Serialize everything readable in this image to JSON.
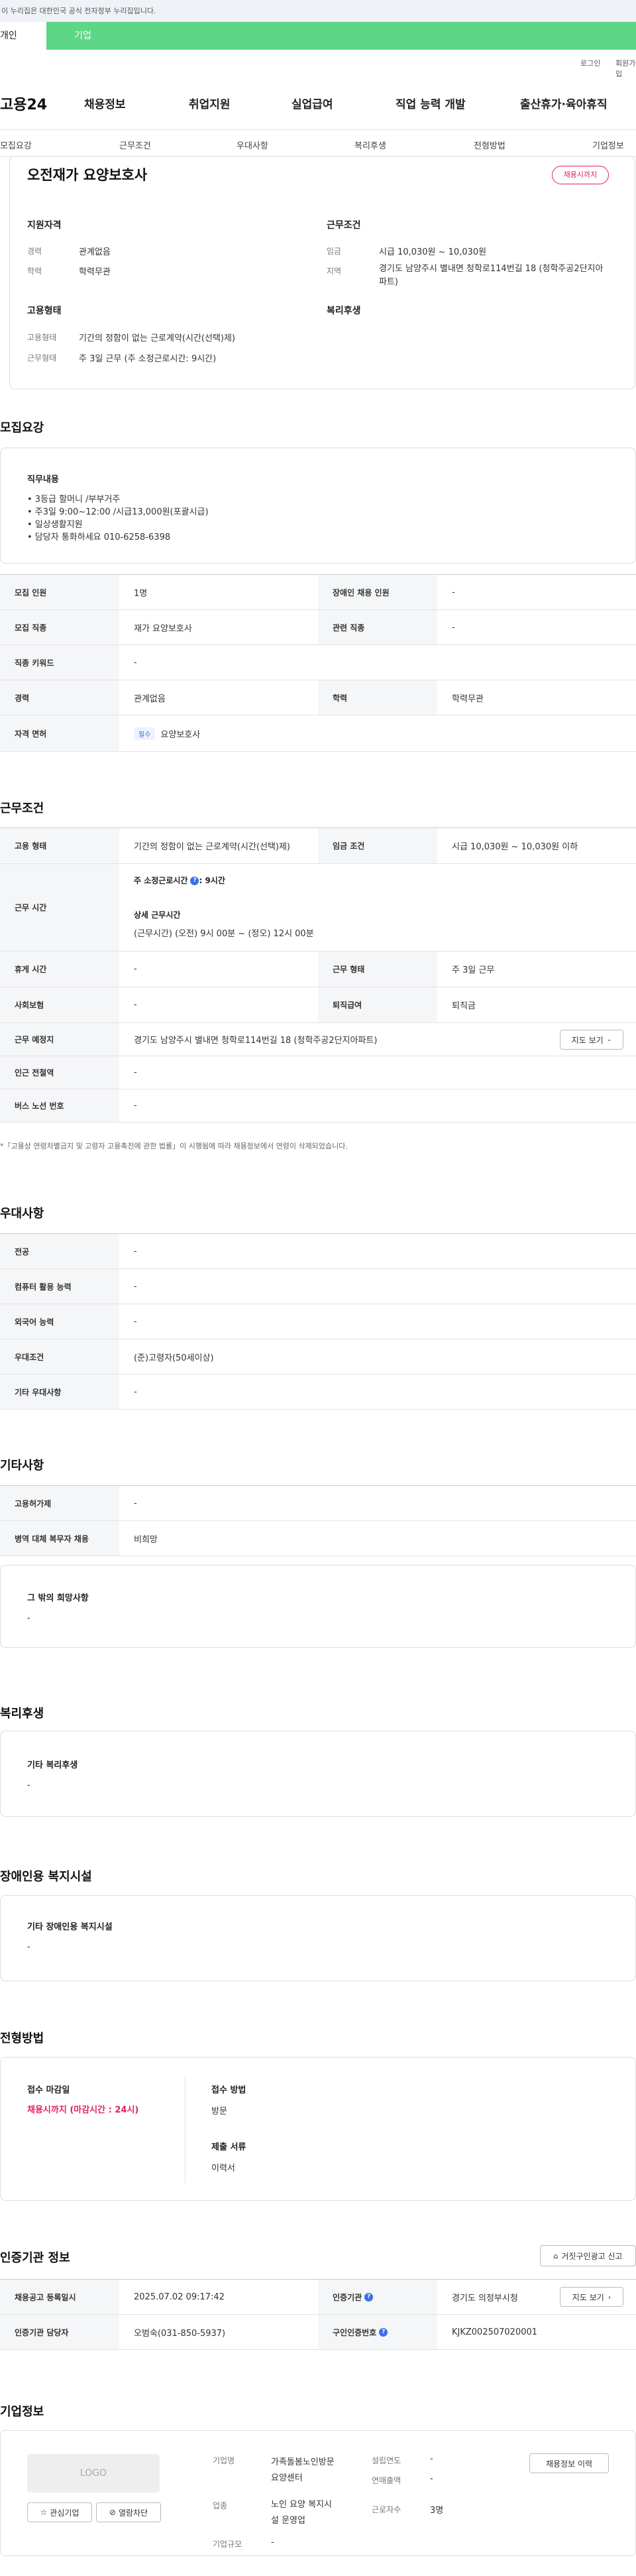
{
  "gov_banner": "이 누리집은 대한민국 공식 전자정부 누리집입니다.",
  "tabs": {
    "active": "개인",
    "business": "기업"
  },
  "util": {
    "login": "로그인",
    "join": "회원가입"
  },
  "logo": "고용24",
  "gnb": [
    "채용정보",
    "취업지원",
    "실업급여",
    "직업 능력 개발",
    "출산휴가·육아휴직"
  ],
  "subnav": [
    "모집요강",
    "근무조건",
    "우대사항",
    "복리후생",
    "전형방법",
    "기업정보"
  ],
  "job": {
    "title": "오전재가 요양보호사",
    "badge": "채용시까지",
    "support_h": "지원자격",
    "career_l": "경력",
    "career_v": "관계없음",
    "edu_l": "학력",
    "edu_v": "학력무관",
    "cond_h": "근무조건",
    "wage_l": "임금",
    "wage_v": "시급 10,030원 ~ 10,030원",
    "region_l": "지역",
    "region_v": "경기도 남양주시 별내면 청학로114번길 18 (청학주공2단지아파트)",
    "emp_h": "고용형태",
    "emptype_l": "고용형태",
    "emptype_v": "기간의 정함이 없는 근로계약(시간(선택)제)",
    "worktype_l": "근무형태",
    "worktype_v": "주 3일 근무 (주 소정근로시간: 9시간)",
    "welfare_h": "복리후생"
  },
  "recruit": {
    "heading": "모집요강",
    "duty_h": "직무내용",
    "duties": [
      "• 3등급 할머니 /부부거주",
      "• 주3일  9:00~12:00 /시급13,000원(포괄시급)",
      "• 일상생활지원",
      "• 담당자 통화하세요 010-6258-6398"
    ],
    "rows": {
      "count_l": "모집 인원",
      "count_v": "1명",
      "disabled_l": "장애인 채용 인원",
      "disabled_v": "-",
      "job_l": "모집 직종",
      "job_v": "재가 요양보호사",
      "related_l": "관련 직종",
      "related_v": "-",
      "kw_l": "직종 키워드",
      "kw_v": "-",
      "career_l": "경력",
      "career_v": "관계없음",
      "edu_l": "학력",
      "edu_v": "학력무관",
      "license_l": "자격 면허",
      "license_tag": "필수",
      "license_v": "요양보호사"
    }
  },
  "work": {
    "heading": "근무조건",
    "emp_l": "고용 형태",
    "emp_v": "기간의 정함이 없는 근로계약(시간(선택)제)",
    "wage_l": "임금 조건",
    "wage_v": "시급 10,030원 ~ 10,030원 이하",
    "time_l": "근무 시간",
    "time_week": "주 소정근로시간",
    "time_hours": ": 9시간",
    "time_detail_h": "상세 근무시간",
    "time_detail_v": "(근무시간) (오전) 9시 00분 ~ (정오) 12시 00분",
    "rest_l": "휴게 시간",
    "rest_v": "-",
    "form_l": "근무 형태",
    "form_v": "주 3일 근무",
    "ins_l": "사회보험",
    "ins_v": "-",
    "retire_l": "퇴직급여",
    "retire_v": "퇴직금",
    "place_l": "근무 예정지",
    "place_v": "경기도 남양주시 별내면 청학로114번길 18 (청학주공2단지아파트)",
    "map_btn": "지도 보기",
    "subway_l": "인근 전철역",
    "subway_v": "-",
    "bus_l": "버스 노선 번호",
    "bus_v": "-",
    "note": "*「고용상 연령차별금지 및 고령자 고용촉진에 관한 법률」이 시행됨에 따라 채용정보에서 연령이 삭제되었습니다."
  },
  "pref": {
    "heading": "우대사항",
    "major_l": "전공",
    "major_v": "-",
    "pc_l": "컴퓨터 활용 능력",
    "pc_v": "-",
    "lang_l": "외국어 능력",
    "lang_v": "-",
    "cond_l": "우대조건",
    "cond_v": "(준)고령자(50세이상)",
    "etc_l": "기타 우대사항",
    "etc_v": "-"
  },
  "other": {
    "heading": "기타사항",
    "hire_l": "고용허가제",
    "hire_v": "-",
    "mil_l": "병역 대체 복무자 채용",
    "mil_v": "비희망",
    "wish_h": "그 밖의 희망사항",
    "wish_v": "-"
  },
  "welfare": {
    "heading": "복리후생",
    "sub": "기타 복리후생",
    "v": "-"
  },
  "facility": {
    "heading": "장애인용 복지시설",
    "sub": "기타 장애인용 복지시설",
    "v": "-"
  },
  "process": {
    "heading": "전형방법",
    "deadline_h": "접수 마감일",
    "deadline_v": "채용시까지 (마감시간 : 24시)",
    "method_h": "접수 방법",
    "method_v": "방문",
    "docs_h": "제출 서류",
    "docs_v": "이력서"
  },
  "cert": {
    "heading": "인증기관 정보",
    "report_btn": "거짓구인광고 신고",
    "date_l": "채용공고 등록일시",
    "date_v": "2025.07.02 09:17:42",
    "agency_l": "인증기관",
    "agency_v": "경기도 의정부시청",
    "map_btn": "지도 보기",
    "manager_l": "인증기관 담당자",
    "manager_v": "오범숙(031-850-5937)",
    "num_l": "구인인증번호",
    "num_v": "KJKZ002507020001"
  },
  "company": {
    "heading": "기업정보",
    "logo": "LOGO",
    "fav_btn": "관심기업",
    "block_btn": "열람차단",
    "name_l": "기업명",
    "name_v1": "가족돌봄노인방문",
    "name_v2": "요양센터",
    "ind_l": "업종",
    "ind_v1": "노인 요양 복지시",
    "ind_v2": "설 운영업",
    "size_l": "기업규모",
    "size_v": "-",
    "year_l": "설립연도",
    "year_v": "-",
    "sales_l": "연매출액",
    "sales_v": "-",
    "emp_l": "근로자수",
    "emp_v": "3명",
    "history_btn": "채용정보 이력"
  }
}
